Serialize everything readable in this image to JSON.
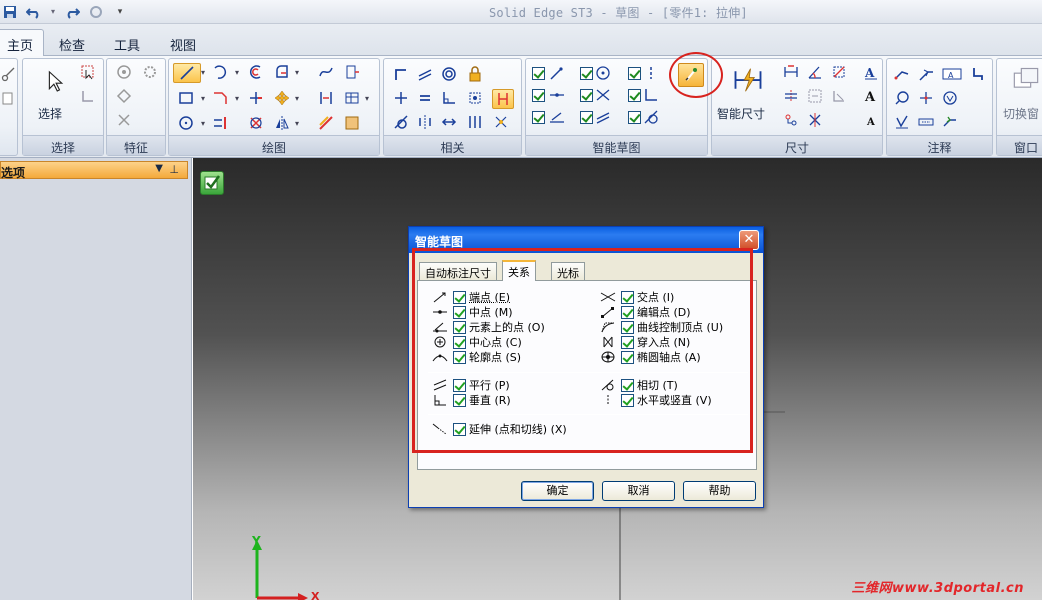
{
  "app": {
    "title": "Solid Edge ST3 - 草图 - [零件1: 拉伸]"
  },
  "tabs": [
    "主页",
    "检查",
    "工具",
    "视图"
  ],
  "ribbon": {
    "select_label": "选择",
    "smart_dim_label": "智能尺寸",
    "window_switch_label": "切换窗",
    "groups": [
      "选择",
      "特征",
      "绘图",
      "相关",
      "智能草图",
      "尺寸",
      "注释",
      "窗口"
    ]
  },
  "left_panel": {
    "title": "选项"
  },
  "dialog": {
    "title": "智能草图",
    "close": "✕",
    "tabs": [
      "自动标注尺寸",
      "关系",
      "光标"
    ],
    "active_tab": "关系",
    "options_left": [
      {
        "label": "端点 (E)",
        "icon": "endpoint-icon",
        "checked": true
      },
      {
        "label": "中点 (M)",
        "icon": "midpoint-icon",
        "checked": true
      },
      {
        "label": "元素上的点 (O)",
        "icon": "point-on-element-icon",
        "checked": true
      },
      {
        "label": "中心点 (C)",
        "icon": "center-point-icon",
        "checked": true
      },
      {
        "label": "轮廓点 (S)",
        "icon": "silhouette-point-icon",
        "checked": true
      }
    ],
    "options_right": [
      {
        "label": "交点 (I)",
        "icon": "intersection-icon",
        "checked": true
      },
      {
        "label": "编辑点 (D)",
        "icon": "edit-point-icon",
        "checked": true
      },
      {
        "label": "曲线控制顶点 (U)",
        "icon": "curve-control-vertex-icon",
        "checked": true
      },
      {
        "label": "穿入点 (N)",
        "icon": "pierce-point-icon",
        "checked": true
      },
      {
        "label": "椭圆轴点 (A)",
        "icon": "ellipse-axis-point-icon",
        "checked": true
      }
    ],
    "options_rel_left": [
      {
        "label": "平行 (P)",
        "icon": "parallel-icon",
        "checked": true
      },
      {
        "label": "垂直 (R)",
        "icon": "perpendicular-icon",
        "checked": true
      }
    ],
    "options_rel_right": [
      {
        "label": "相切 (T)",
        "icon": "tangent-icon",
        "checked": true
      },
      {
        "label": "水平或竖直 (V)",
        "icon": "horizontal-vertical-icon",
        "checked": true
      }
    ],
    "extension": {
      "label": "延伸 (点和切线) (X)",
      "icon": "extension-icon",
      "checked": true
    },
    "buttons": {
      "ok": "确定",
      "cancel": "取消",
      "help": "帮助"
    }
  },
  "axes": {
    "y": "Y",
    "x": "X"
  },
  "watermark": "三维网www.3dportal.cn",
  "colors": {
    "highlight_red": "#d8231f",
    "panel_orange": "#f4a93b",
    "dialog_blue": "#0a52d3"
  }
}
